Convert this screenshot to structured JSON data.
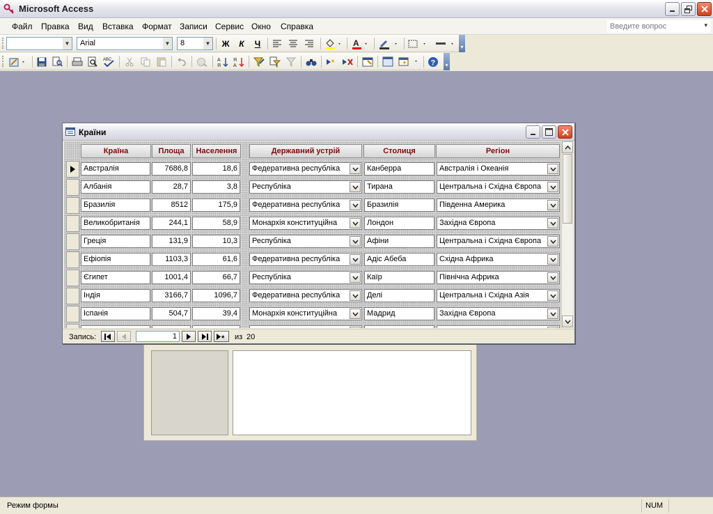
{
  "app": {
    "title": "Microsoft Access"
  },
  "menu": {
    "items": [
      {
        "u": "Ф",
        "rest": "айл"
      },
      {
        "u": "П",
        "rest": "равка"
      },
      {
        "u": "В",
        "rest": "ид"
      },
      {
        "u": "",
        "pre": "Вст",
        "mid": "а",
        "rest": "вка"
      },
      {
        "u": "",
        "pre": "Ф",
        "mid": "о",
        "rest": "рмат"
      },
      {
        "u": "З",
        "rest": "аписи"
      },
      {
        "u": "",
        "pre": "С",
        "mid": "е",
        "rest": "рвис"
      },
      {
        "u": "О",
        "rest": "кно"
      },
      {
        "u": "С",
        "rest": "правка"
      }
    ],
    "labels": [
      "Файл",
      "Правка",
      "Вид",
      "Вставка",
      "Формат",
      "Записи",
      "Сервис",
      "Окно",
      "Справка"
    ],
    "help_placeholder": "Введите вопрос"
  },
  "format_toolbar": {
    "object_value": "",
    "font": "Arial",
    "size": "8",
    "bold": "Ж",
    "italic": "К",
    "underline": "Ч"
  },
  "form_window": {
    "title": "Країни",
    "columns": [
      "Країна",
      "Площа",
      "Населення",
      "Державний устрій",
      "Столиця",
      "Регіон"
    ],
    "rows": [
      {
        "country": "Австралія",
        "area": "7686,8",
        "population": "18,6",
        "government": "Федеративна республіка",
        "capital": "Канберра",
        "region": "Австралія і Океанія"
      },
      {
        "country": "Албанія",
        "area": "28,7",
        "population": "3,8",
        "government": "Республіка",
        "capital": "Тирана",
        "region": "Центральна і Східна Європа"
      },
      {
        "country": "Бразилія",
        "area": "8512",
        "population": "175,9",
        "government": "Федеративна республіка",
        "capital": "Бразилія",
        "region": "Південна Америка"
      },
      {
        "country": "Великобританія",
        "area": "244,1",
        "population": "58,9",
        "government": "Монархія конституційна",
        "capital": "Лондон",
        "region": "Західна Європа"
      },
      {
        "country": "Греція",
        "area": "131,9",
        "population": "10,3",
        "government": "Республіка",
        "capital": "Афіни",
        "region": "Центральна і Східна Європа"
      },
      {
        "country": "Ефіопія",
        "area": "1103,3",
        "population": "61,6",
        "government": "Федеративна республіка",
        "capital": "Адіс Абеба",
        "region": "Східна Африка"
      },
      {
        "country": "Єгипет",
        "area": "1001,4",
        "population": "66,7",
        "government": "Республіка",
        "capital": "Каїр",
        "region": "Північна Африка"
      },
      {
        "country": "Індія",
        "area": "3166,7",
        "population": "1096,7",
        "government": "Федеративна республіка",
        "capital": "Делі",
        "region": "Центральна і Східна Азія"
      },
      {
        "country": "Іспанія",
        "area": "504,7",
        "population": "39,4",
        "government": "Монархія конституційна",
        "capital": "Мадрид",
        "region": "Західна Європа"
      }
    ],
    "nav": {
      "label": "Запись:",
      "current": "1",
      "of": "из",
      "total": "20"
    }
  },
  "status": {
    "mode": "Режим формы",
    "num": "NUM"
  },
  "colors": {
    "workspace": "#9c9cb5",
    "header_text": "#7a0b0b"
  }
}
